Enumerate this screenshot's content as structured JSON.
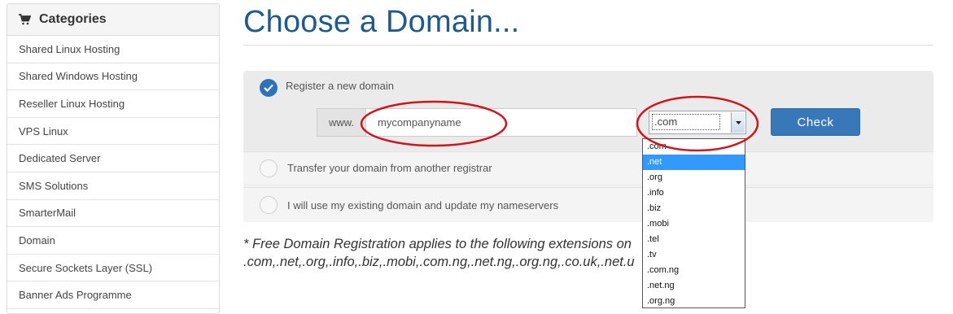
{
  "sidebar": {
    "header_icon": "shopping-cart-icon",
    "header": "Categories",
    "items": [
      {
        "label": "Shared Linux Hosting"
      },
      {
        "label": "Shared Windows Hosting"
      },
      {
        "label": "Reseller Linux Hosting"
      },
      {
        "label": "VPS Linux"
      },
      {
        "label": "Dedicated Server"
      },
      {
        "label": "SMS Solutions"
      },
      {
        "label": "SmarterMail"
      },
      {
        "label": "Domain"
      },
      {
        "label": "Secure Sockets Layer (SSL)"
      },
      {
        "label": "Banner Ads Programme"
      }
    ]
  },
  "main": {
    "title": "Choose a Domain...",
    "options": {
      "register": {
        "label": "Register a new domain",
        "checked": true
      },
      "transfer": {
        "label": "Transfer your domain from another registrar",
        "checked": false
      },
      "existing": {
        "label": "I will use my existing domain and update my nameservers",
        "checked": false
      }
    },
    "domain_form": {
      "prefix": "www.",
      "input_value": "mycompanyname",
      "tld_selected": ".com",
      "check_label": "Check"
    },
    "tld_dropdown": {
      "options": [
        ".com",
        ".net",
        ".org",
        ".info",
        ".biz",
        ".mobi",
        ".tel",
        ".tv",
        ".com.ng",
        ".net.ng",
        ".org.ng"
      ],
      "highlighted": ".net"
    },
    "footnote": {
      "line1": "* Free Domain Registration applies to the following extensions on",
      "line2": ".com,.net,.org,.info,.biz,.mobi,.com.ng,.net.ng,.org.ng,.co.uk,.net.u"
    }
  },
  "colors": {
    "title": "#1e5a8e",
    "button": "#3878b8",
    "radio_checked": "#2b74b9",
    "dropdown_highlight": "#3399ff",
    "annotation": "#d0141c"
  }
}
